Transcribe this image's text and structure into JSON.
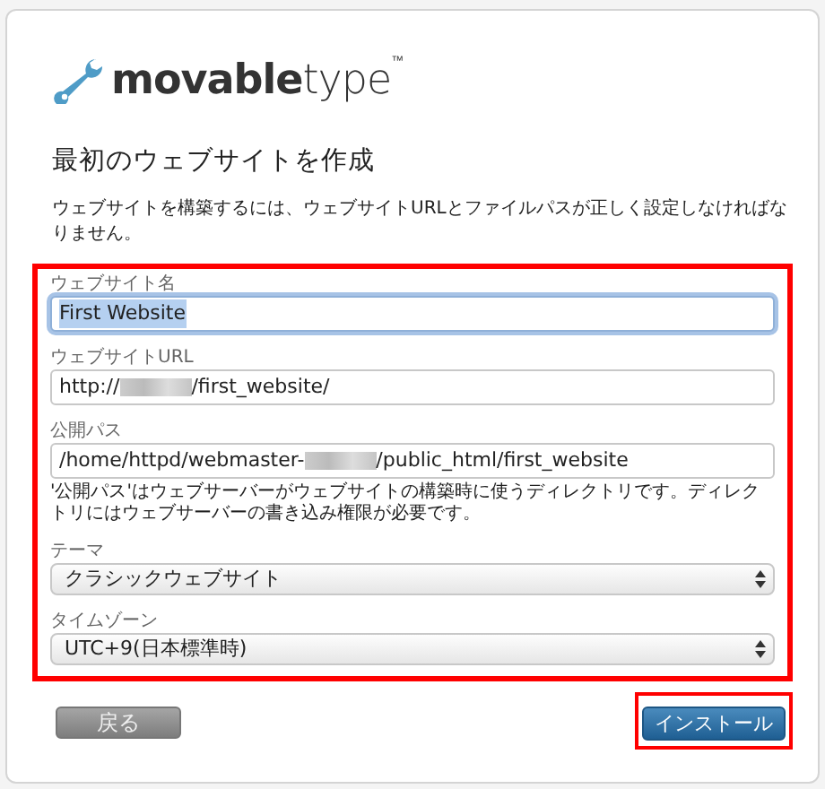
{
  "logo": {
    "text": "**movable**type$^{™}$"
  },
  "heading": "最初のウェブサイトを作成",
  "description": "ウェブサイトを構築するには、ウェブサイトURLとファイルパスが正しく設定しなければなりません。",
  "form": {
    "highlighted": true,
    "fields": [
      {
        "kind": "text",
        "label": "ウェブサイト名",
        "value_before": "First Website",
        "focused": true,
        "text_selected": true
      },
      {
        "kind": "text",
        "label": "ウェブサイトURL",
        "value_before": "http://",
        "redacted": true,
        "value_after": "/first_website/",
        "focused": false,
        "text_selected": false
      },
      {
        "kind": "text",
        "label": "公開パス",
        "value_before": "/home/httpd/webmaster-",
        "redacted": true,
        "value_after": "/public_html/first_website",
        "focused": false,
        "text_selected": false,
        "hint": "'公開パス'はウェブサーバーがウェブサイトの構築時に使うディレクトリです。ディレクトリにはウェブサーバーの書き込み権限が必要です。"
      },
      {
        "kind": "select",
        "label": "テーマ",
        "value_before": "クラシックウェブサイト"
      },
      {
        "kind": "select",
        "label": "タイムゾーン",
        "value_before": "UTC+9(日本標準時)"
      }
    ]
  },
  "buttons": [
    {
      "kind": "back",
      "label": "戻る",
      "highlighted": false
    },
    {
      "kind": "primary",
      "label": "インストール",
      "highlighted": true
    }
  ]
}
